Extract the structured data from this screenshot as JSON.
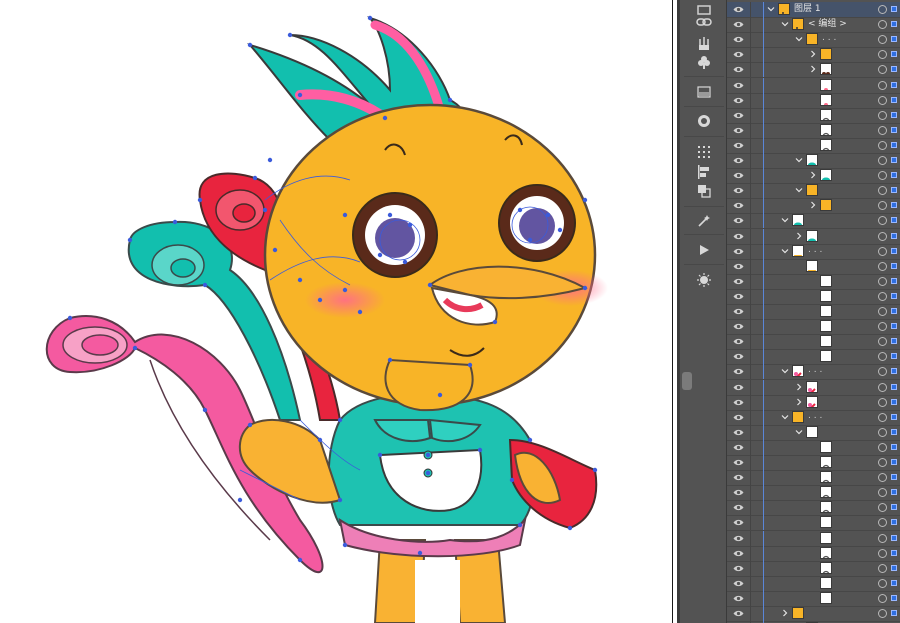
{
  "layers_panel": {
    "top_layer": {
      "label": "图层 1"
    },
    "group_label": "< 编组 >",
    "sublabel": ". . .",
    "selection_color": "#2f6fe0",
    "rows": [
      {
        "level": 1,
        "chev": "down",
        "label": "图层 1",
        "thumb": "chick",
        "sel": true
      },
      {
        "level": 2,
        "chev": "down",
        "label": "< 编组 >",
        "thumb": "chick"
      },
      {
        "level": 3,
        "chev": "down",
        "label": ". . .",
        "thumb": "orange"
      },
      {
        "level": 4,
        "chev": "right",
        "label": "",
        "thumb": "orange-small"
      },
      {
        "level": 4,
        "chev": "right",
        "label": "",
        "thumb": "eyes"
      },
      {
        "level": 4,
        "chev": "",
        "label": "",
        "thumb": "pink-dot"
      },
      {
        "level": 4,
        "chev": "",
        "label": "",
        "thumb": "pink-dot"
      },
      {
        "level": 4,
        "chev": "",
        "label": "",
        "thumb": "arc"
      },
      {
        "level": 4,
        "chev": "",
        "label": "",
        "thumb": "arc2"
      },
      {
        "level": 4,
        "chev": "",
        "label": "",
        "thumb": "arc3"
      },
      {
        "level": 3,
        "chev": "down",
        "label": "",
        "thumb": "teal-blob"
      },
      {
        "level": 4,
        "chev": "right",
        "label": "",
        "thumb": "teal-blob"
      },
      {
        "level": 3,
        "chev": "down",
        "label": "",
        "thumb": "orange"
      },
      {
        "level": 4,
        "chev": "right",
        "label": "",
        "thumb": "orange"
      },
      {
        "level": 2,
        "chev": "down",
        "label": "",
        "thumb": "teal-oval"
      },
      {
        "level": 3,
        "chev": "right",
        "label": "",
        "thumb": "teal-oval"
      },
      {
        "level": 2,
        "chev": "down",
        "label": ". . .",
        "thumb": "orange-bowl"
      },
      {
        "level": 3,
        "chev": "",
        "label": "",
        "thumb": "orange-bowl"
      },
      {
        "level": 4,
        "chev": "",
        "label": "",
        "thumb": "blank"
      },
      {
        "level": 4,
        "chev": "",
        "label": "",
        "thumb": "blank"
      },
      {
        "level": 4,
        "chev": "",
        "label": "",
        "thumb": "blank"
      },
      {
        "level": 4,
        "chev": "",
        "label": "",
        "thumb": "blank"
      },
      {
        "level": 4,
        "chev": "",
        "label": "",
        "thumb": "blank"
      },
      {
        "level": 4,
        "chev": "",
        "label": "",
        "thumb": "blank"
      },
      {
        "level": 2,
        "chev": "down",
        "label": ". . .",
        "thumb": "feather"
      },
      {
        "level": 3,
        "chev": "right",
        "label": "",
        "thumb": "feather"
      },
      {
        "level": 3,
        "chev": "right",
        "label": "",
        "thumb": "feather"
      },
      {
        "level": 2,
        "chev": "down",
        "label": ". . .",
        "thumb": "orange-sq"
      },
      {
        "level": 3,
        "chev": "down",
        "label": "",
        "thumb": "blank"
      },
      {
        "level": 4,
        "chev": "",
        "label": "",
        "thumb": "blank"
      },
      {
        "level": 4,
        "chev": "",
        "label": "",
        "thumb": "arc"
      },
      {
        "level": 4,
        "chev": "",
        "label": "",
        "thumb": "arc"
      },
      {
        "level": 4,
        "chev": "",
        "label": "",
        "thumb": "arc2"
      },
      {
        "level": 4,
        "chev": "",
        "label": "",
        "thumb": "arc3"
      },
      {
        "level": 4,
        "chev": "",
        "label": "",
        "thumb": "blank"
      },
      {
        "level": 4,
        "chev": "",
        "label": "",
        "thumb": "blank"
      },
      {
        "level": 4,
        "chev": "",
        "label": "",
        "thumb": "arc"
      },
      {
        "level": 4,
        "chev": "",
        "label": "",
        "thumb": "arc2"
      },
      {
        "level": 4,
        "chev": "",
        "label": "",
        "thumb": "blank"
      },
      {
        "level": 4,
        "chev": "",
        "label": "",
        "thumb": "blank"
      },
      {
        "level": 2,
        "chev": "right",
        "label": "",
        "thumb": "orange-sq"
      },
      {
        "level": 3,
        "chev": "",
        "label": "",
        "thumb": "blank"
      }
    ]
  },
  "toolbar": {
    "tools": [
      "layers-icon",
      "links-icon",
      "puppet-warp-icon",
      "club-symbol-icon",
      "gradient-icon",
      "color-guide-icon",
      "distribute-icon",
      "align-icon",
      "pathfinder-icon",
      "magic-wand-icon",
      "play-icon",
      "sun-icon"
    ]
  },
  "canvas": {
    "background": "#ffffff",
    "path_highlight": "#3b5bdb"
  }
}
